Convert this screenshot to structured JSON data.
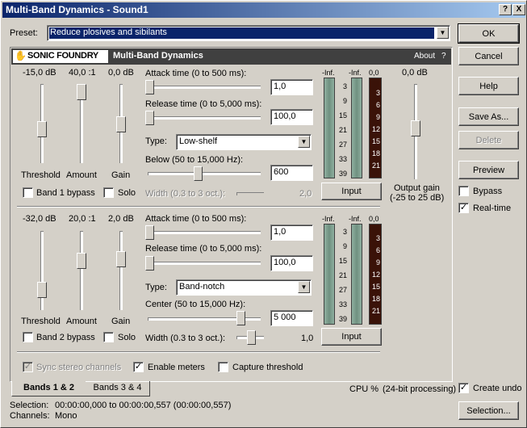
{
  "window": {
    "title": "Multi-Band Dynamics - Sound1"
  },
  "titlebar": {
    "help_glyph": "?",
    "close_glyph": "X"
  },
  "preset": {
    "label": "Preset:",
    "value": "Reduce plosives and sibilants"
  },
  "header": {
    "brand": "SONIC FOUNDRY",
    "plugin_title": "Multi-Band Dynamics",
    "about": "About",
    "help": "?"
  },
  "buttons": {
    "ok": "OK",
    "cancel": "Cancel",
    "help": "Help",
    "save_as": "Save As...",
    "delete": "Delete",
    "preview": "Preview",
    "selection": "Selection..."
  },
  "right_options": {
    "bypass": "Bypass",
    "bypass_checked": false,
    "realtime": "Real-time",
    "realtime_checked": true,
    "create_undo": "Create undo",
    "create_undo_checked": true
  },
  "band1": {
    "threshold_value": "-15,0 dB",
    "amount_value": "40,0 :1",
    "gain_value": "0,0 dB",
    "threshold_label": "Threshold",
    "amount_label": "Amount",
    "gain_label": "Gain",
    "bypass_label": "Band 1 bypass",
    "solo_label": "Solo",
    "attack_label": "Attack time (0 to 500 ms):",
    "attack_value": "1,0",
    "release_label": "Release time (0 to 5,000 ms):",
    "release_value": "100,0",
    "type_label": "Type:",
    "type_value": "Low-shelf",
    "freq_label": "Below (50 to 15,000 Hz):",
    "freq_value": "600",
    "width_label": "Width (0.3 to 3 oct.):",
    "width_value": "2,0",
    "input_button": "Input"
  },
  "band2": {
    "threshold_value": "-32,0 dB",
    "amount_value": "20,0 :1",
    "gain_value": "2,0 dB",
    "threshold_label": "Threshold",
    "amount_label": "Amount",
    "gain_label": "Gain",
    "bypass_label": "Band 2 bypass",
    "solo_label": "Solo",
    "attack_label": "Attack time (0 to 500 ms):",
    "attack_value": "1,0",
    "release_label": "Release time (0 to 5,000 ms):",
    "release_value": "100,0",
    "type_label": "Type:",
    "type_value": "Band-notch",
    "freq_label": "Center (50 to 15,000 Hz):",
    "freq_value": "5 000",
    "width_label": "Width (0.3 to 3 oct.):",
    "width_value": "1,0",
    "input_button": "Input"
  },
  "meters": {
    "inf1": "-Inf.",
    "inf2": "-Inf.",
    "top_val": "0,0",
    "left_scale": [
      "3",
      "9",
      "15",
      "21",
      "27",
      "33",
      "39"
    ],
    "right_scale": [
      "3",
      "6",
      "9",
      "12",
      "15",
      "18",
      "21"
    ]
  },
  "output": {
    "value": "0,0 dB",
    "label1": "Output gain",
    "label2": "(-25 to 25 dB)"
  },
  "bottom_options": {
    "sync": "Sync stereo channels",
    "enable_meters": "Enable meters",
    "capture": "Capture threshold"
  },
  "tabs": {
    "tab1": "Bands 1 & 2",
    "tab2": "Bands 3 & 4"
  },
  "status": {
    "cpu": "CPU %",
    "processing": "(24-bit processing)"
  },
  "footer": {
    "selection_label": "Selection:",
    "selection_value": "00:00:00,000 to 00:00:00,557 (00:00:00,557)",
    "channels_label": "Channels:",
    "channels_value": "Mono"
  }
}
